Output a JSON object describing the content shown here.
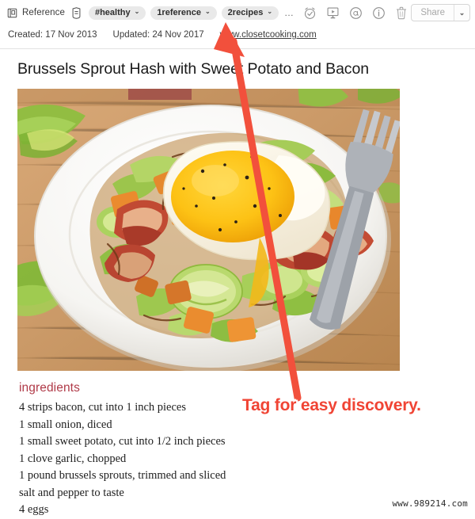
{
  "toolbar": {
    "reference_label": "Reference",
    "reference_icon": "book-reference-icon",
    "tag_icon": "tag-icon",
    "pills": [
      {
        "label": "#healthy",
        "chevron": "⌄"
      },
      {
        "label": "1reference",
        "chevron": "⌄"
      },
      {
        "label": "2recipes",
        "chevron": "⌄"
      }
    ],
    "overflow": "…",
    "icons": [
      {
        "name": "reminder-alarm-icon",
        "title": "Reminder"
      },
      {
        "name": "presentation-icon",
        "title": "Presentation"
      },
      {
        "name": "annotation-icon",
        "title": "Annotation"
      },
      {
        "name": "info-icon",
        "title": "Info"
      },
      {
        "name": "trash-icon",
        "title": "Delete"
      }
    ],
    "share_label": "Share",
    "share_chevron": "⌄"
  },
  "meta": {
    "created": "Created: 17 Nov 2013",
    "updated": "Updated: 24 Nov 2017",
    "source_url": "www.closetcooking.com"
  },
  "note": {
    "title": "Brussels Sprout Hash with Sweet Potato and Bacon",
    "photo_alt": "Plate of brussels sprout hash with fried egg, bacon and sweet potato",
    "ingredients_heading": "ingredients",
    "ingredients": [
      "4 strips bacon, cut into 1 inch pieces",
      "1 small onion, diced",
      "1 small sweet potato, cut into 1/2 inch pieces",
      "1 clove garlic, chopped",
      "1 pound brussels sprouts, trimmed and sliced",
      "salt and pepper to taste",
      "4 eggs"
    ]
  },
  "annotation": {
    "text": "Tag for easy discovery.",
    "color": "#f04434",
    "arrow_color": "#f04434"
  },
  "watermark": {
    "text": "www.989214.com"
  }
}
